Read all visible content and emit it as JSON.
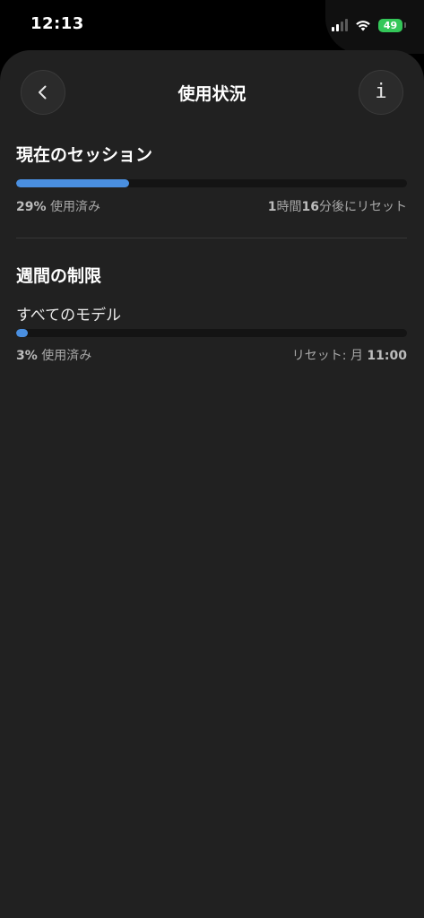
{
  "status_bar": {
    "time": "12:13",
    "battery": "49"
  },
  "nav": {
    "title": "使用状況",
    "info_glyph": "i"
  },
  "current_session": {
    "title": "現在のセッション",
    "used_percent": 29,
    "used_num": "29%",
    "used_suffix": " 使用済み",
    "reset_h": "1",
    "reset_h_unit": "時間",
    "reset_m": "16",
    "reset_m_unit": "分後にリセット"
  },
  "weekly_limit": {
    "title": "週間の制限",
    "models": [
      {
        "label": "すべてのモデル",
        "used_percent": 3,
        "used_num": "3%",
        "used_suffix": " 使用済み",
        "reset_prefix": "リセット: 月 ",
        "reset_time": "11:00"
      }
    ]
  },
  "colors": {
    "progress": "#4a8fe0",
    "background": "#212121",
    "battery": "#34c759"
  },
  "icons": {
    "back": "chevron-left-icon",
    "info": "info-icon",
    "signal": "cellular-signal-icon",
    "wifi": "wifi-icon",
    "battery": "battery-charging-icon"
  }
}
